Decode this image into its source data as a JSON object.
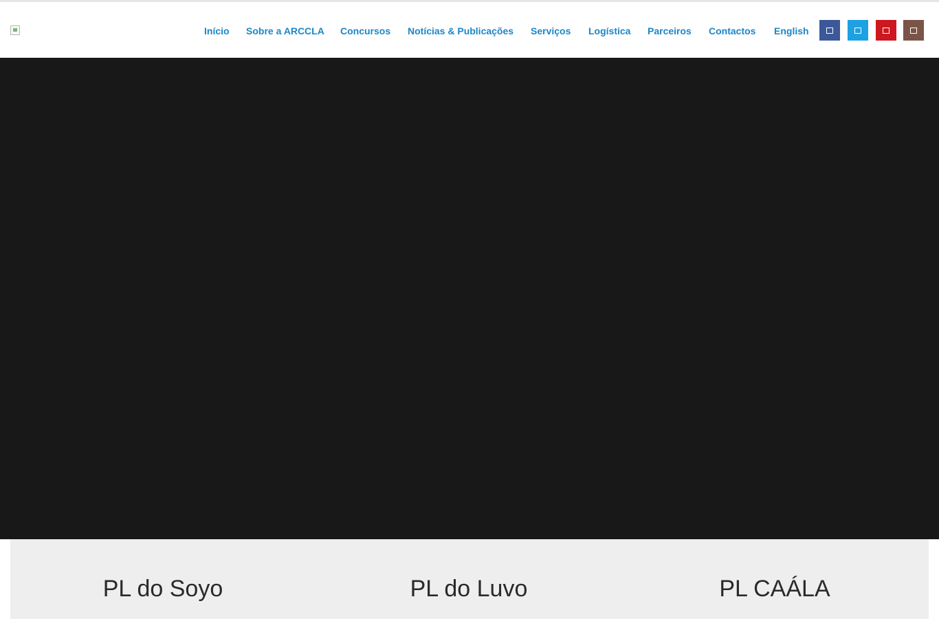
{
  "nav": {
    "items": [
      {
        "label": "Início"
      },
      {
        "label": "Sobre a ARCCLA"
      },
      {
        "label": "Concursos"
      },
      {
        "label": "Notícias & Publicações"
      },
      {
        "label": "Serviços"
      },
      {
        "label": "Logística"
      },
      {
        "label": "Parceiros"
      },
      {
        "label": "Contactos"
      },
      {
        "label": "English"
      }
    ]
  },
  "social": [
    {
      "name": "facebook-icon",
      "color": "#3b5998"
    },
    {
      "name": "twitter-icon",
      "color": "#1da1e2"
    },
    {
      "name": "youtube-icon",
      "color": "#cc181e"
    },
    {
      "name": "instagram-icon",
      "color": "#7a5547"
    }
  ],
  "cards": [
    {
      "title": "PL do Soyo"
    },
    {
      "title": "PL do Luvo"
    },
    {
      "title": "PL CAÁLA"
    }
  ],
  "colors": {
    "nav_link": "#1c86c8",
    "hero_bg": "#181818",
    "cards_bg": "#eeeeee"
  }
}
